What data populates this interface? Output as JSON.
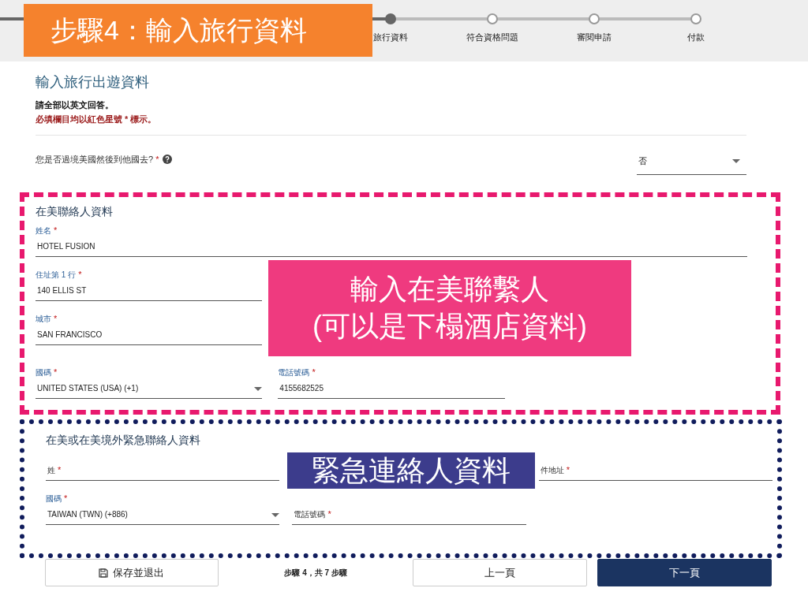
{
  "banner": {
    "text": "步驟4：輸入旅行資料"
  },
  "stepper": [
    {
      "label": "旅行資料",
      "selected": true
    },
    {
      "label": "符合資格問題",
      "selected": false
    },
    {
      "label": "審閱申請",
      "selected": false
    },
    {
      "label": "付款",
      "selected": false
    }
  ],
  "page_title": "輸入旅行出遊資料",
  "instructions": "請全部以英文回答。",
  "required_note": "必填欄目均以紅色星號 * 標示。",
  "question": {
    "label": "您是否過境美國然後到他國去?",
    "asterisk": "*",
    "answer": "否"
  },
  "sections": [
    {
      "kind": "us_contact",
      "title": "在美聯絡人資料",
      "rows": [
        [
          {
            "kind": "text",
            "label": "姓名",
            "asterisk": "*",
            "value": "HOTEL FUSION",
            "wide": true
          }
        ],
        [
          {
            "kind": "text",
            "label": "住址第 1 行",
            "asterisk": "*",
            "value": "140 ELLIS ST"
          }
        ],
        [
          {
            "kind": "text",
            "label": "城市",
            "asterisk": "*",
            "value": "SAN FRANCISCO"
          }
        ],
        [
          {
            "kind": "select",
            "label": "國碼",
            "asterisk": "*",
            "value": "UNITED STATES (USA) (+1)"
          },
          {
            "kind": "text",
            "label": "電話號碼",
            "asterisk": "*",
            "value": "4155682525"
          }
        ]
      ]
    },
    {
      "kind": "emergency",
      "title": "在美或在美境外緊急聯絡人資料",
      "rows": [
        [
          {
            "kind": "empty",
            "placeholder": "姓",
            "asterisk": "*"
          },
          {
            "kind": "gap"
          },
          {
            "kind": "empty",
            "placeholder": "件地址",
            "asterisk": "*"
          }
        ],
        [
          {
            "kind": "select",
            "label": "國碼",
            "asterisk": "*",
            "value": "TAIWAN (TWN) (+886)"
          },
          {
            "kind": "empty",
            "placeholder": "電話號碼",
            "asterisk": "*"
          }
        ]
      ]
    }
  ],
  "overlays": [
    {
      "kind": "pink",
      "lines": [
        "輸入在美聯繫人",
        "(可以是下榻酒店資料)"
      ]
    },
    {
      "kind": "navy",
      "lines": [
        "緊急連絡人資料"
      ]
    }
  ],
  "footer": {
    "save": "保存並退出",
    "progress": "步驟 4，共 7 步驟",
    "back": "上一頁",
    "next": "下一頁"
  }
}
